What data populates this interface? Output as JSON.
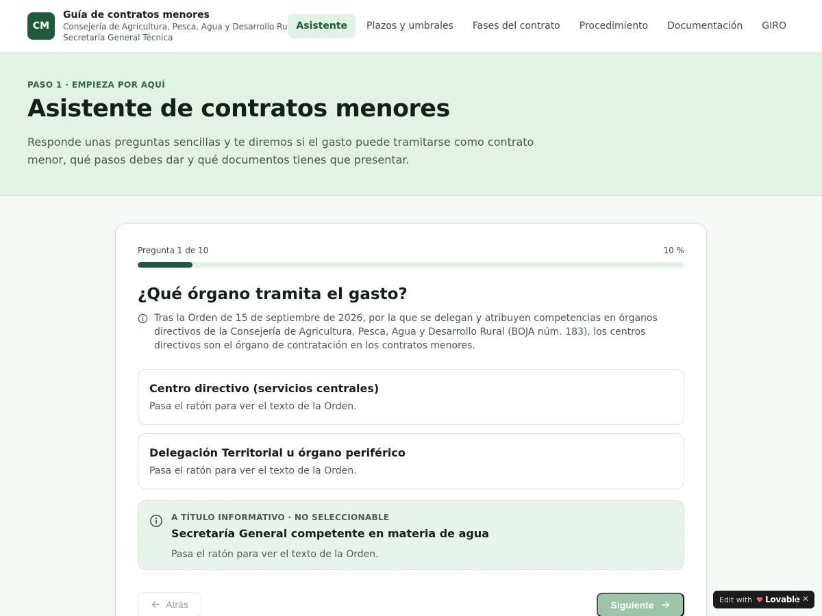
{
  "header": {
    "logo_text": "CM",
    "title": "Guía de contratos menores",
    "subtitle_1": "Consejería de Agricultura, Pesca, Agua y Desarrollo Rural",
    "subtitle_2": "Secretaría General Técnica",
    "nav": [
      {
        "label": "Asistente",
        "active": true
      },
      {
        "label": "Plazos y umbrales",
        "active": false
      },
      {
        "label": "Fases del contrato",
        "active": false
      },
      {
        "label": "Procedimiento",
        "active": false
      },
      {
        "label": "Documentación",
        "active": false
      },
      {
        "label": "GIRO",
        "active": false
      }
    ]
  },
  "hero": {
    "eyebrow": "PASO 1 · EMPIEZA POR AQUÍ",
    "title": "Asistente de contratos menores",
    "description": "Responde unas preguntas sencillas y te diremos si el gasto puede tramitarse como contrato menor, qué pasos debes dar y qué documentos tienes que presentar."
  },
  "wizard": {
    "progress_label": "Pregunta 1 de 10",
    "progress_percent_text": "10 %",
    "progress_value": 0.1,
    "question": "¿Qué órgano tramita el gasto?",
    "note": "Tras la Orden de 15 de septiembre de 2026, por la que se delegan y atribuyen competencias en órganos directivos de la Consejería de Agricultura, Pesca, Agua y Desarrollo Rural (BOJA núm. 183), los centros directivos son el órgano de contratación en los contratos menores.",
    "options": [
      {
        "title": "Centro directivo (servicios centrales)",
        "hint": "Pasa el ratón para ver el texto de la Orden."
      },
      {
        "title": "Delegación Territorial u órgano periférico",
        "hint": "Pasa el ratón para ver el texto de la Orden."
      }
    ],
    "info_option": {
      "eyebrow": "A TÍTULO INFORMATIVO · NO SELECCIONABLE",
      "title": "Secretaría General competente en materia de agua",
      "hint": "Pasa el ratón para ver el texto de la Orden."
    },
    "back_label": "Atrás",
    "next_label": "Siguiente"
  },
  "badge": {
    "edit_with": "Edit with",
    "brand": "Lovable",
    "close": "✕"
  },
  "colors": {
    "primary": "#1e5a3b",
    "hero_bg": "#e2f3e6",
    "active_nav_bg": "#e1f2e5",
    "next_disabled": "#9cc4a9"
  }
}
